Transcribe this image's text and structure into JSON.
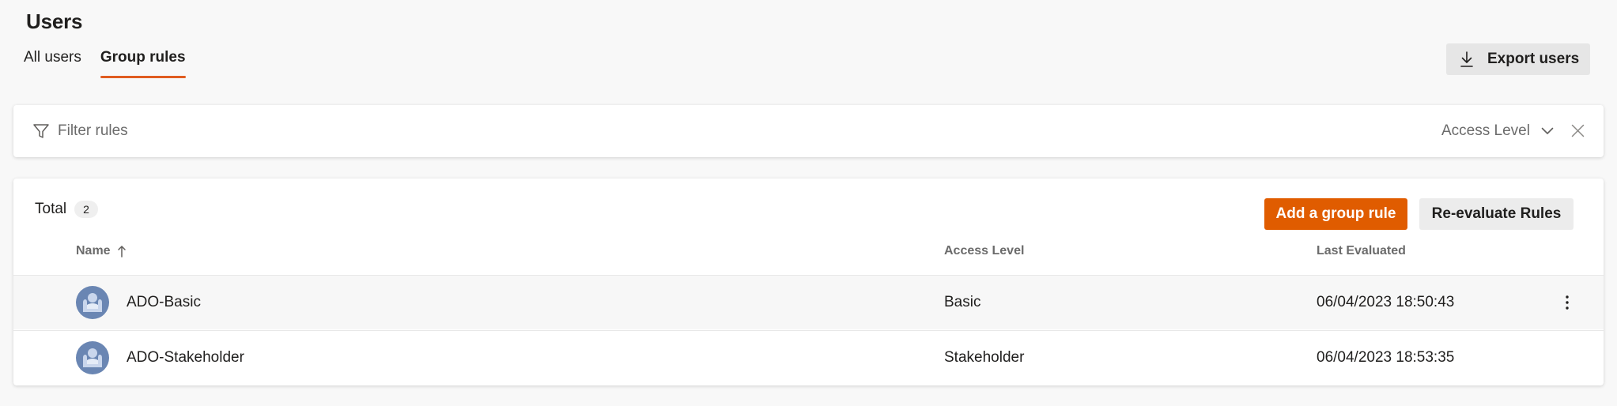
{
  "page": {
    "title": "Users"
  },
  "tabs": [
    {
      "label": "All users",
      "active": false
    },
    {
      "label": "Group rules",
      "active": true
    }
  ],
  "toolbar": {
    "export_label": "Export users",
    "export_icon": "download-icon"
  },
  "filter": {
    "placeholder": "Filter rules",
    "value": "",
    "access_level_label": "Access Level",
    "icons": [
      "filter-icon",
      "chevron-down-icon",
      "close-icon"
    ]
  },
  "summary": {
    "total_label": "Total",
    "total_count": "2"
  },
  "actions": {
    "add_label": "Add a group rule",
    "reevaluate_label": "Re-evaluate Rules"
  },
  "table": {
    "columns": [
      "Name",
      "Access Level",
      "Last Evaluated"
    ],
    "sort": {
      "column": "Name",
      "direction": "ascending"
    },
    "rows": [
      {
        "name": "ADO-Basic",
        "access_level": "Basic",
        "last_evaluated": "06/04/2023 18:50:43"
      },
      {
        "name": "ADO-Stakeholder",
        "access_level": "Stakeholder",
        "last_evaluated": "06/04/2023 18:53:35"
      }
    ]
  },
  "colors": {
    "accent": "#e05c00",
    "tab_underline": "#e05c20",
    "background": "#f8f8f8",
    "avatar": "#6a86b3"
  }
}
